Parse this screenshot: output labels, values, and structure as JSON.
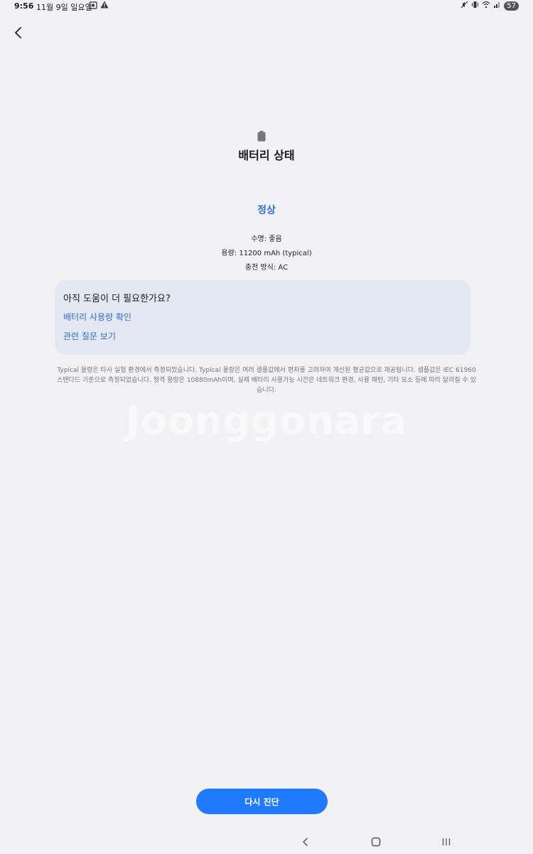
{
  "status_bar": {
    "time": "9:56",
    "date": "11월 9일 일요일",
    "battery_level": "57"
  },
  "header": {
    "title": "배터리 상태"
  },
  "status": {
    "label": "정상"
  },
  "details": {
    "lifespan": "수명: 좋음",
    "capacity": "용량: 11200 mAh (typical)",
    "charging": "충전 방식: AC"
  },
  "help_card": {
    "title": "아직 도움이 더 필요한가요?",
    "link_usage": "배터리 사용량 확인",
    "link_faq": "관련 질문 보기"
  },
  "footnote": "Typical 용량은 타사 실험 환경에서 측정되었습니다. Typical 용량은 여러 샘플값에서 편차를 고려하여 계산된 평균값으로 제공됩니다. 샘플값은 IEC 61960 스탠다드 기준으로 측정되었습니다. 정격 용량은 10880mAh이며, 실제 배터리 사용가능 시간은 네트워크 환경, 사용 패턴, 기타 요소 등에 따라 달라질 수 있습니다.",
  "watermark": "Joonggonara",
  "actions": {
    "rediagnose": "다시 진단"
  },
  "icons": {
    "back": "chevron-left-icon",
    "battery": "battery-icon",
    "nav_back": "nav-back-icon",
    "nav_home": "nav-home-icon",
    "nav_recents": "nav-recents-icon"
  },
  "colors": {
    "accent": "#2f6fd4",
    "button": "#1f7aff",
    "card": "#e3e8f3",
    "background": "#f2f2f4"
  }
}
